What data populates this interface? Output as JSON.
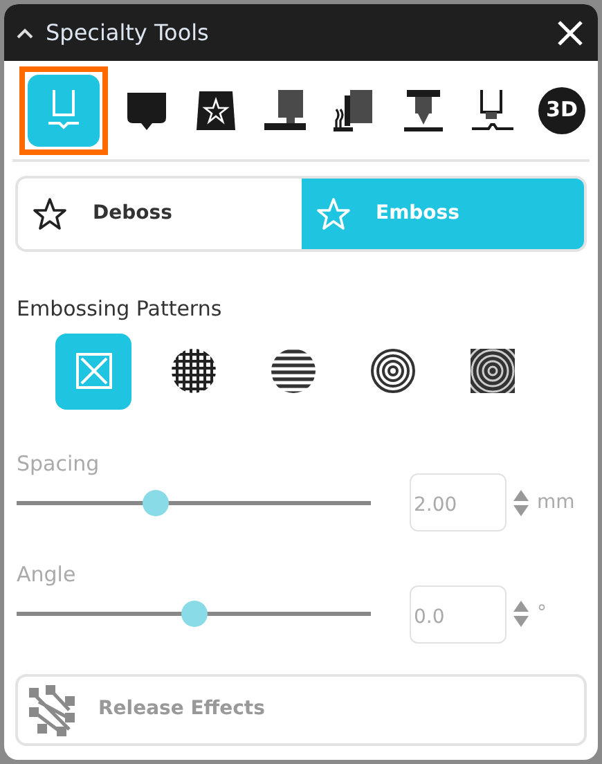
{
  "window": {
    "title": "Specialty Tools"
  },
  "tools": [
    {
      "kind": "cup",
      "selected": true
    },
    {
      "kind": "stamp",
      "selected": false
    },
    {
      "kind": "star",
      "selected": false
    },
    {
      "kind": "press",
      "selected": false
    },
    {
      "kind": "heat",
      "selected": false
    },
    {
      "kind": "drill",
      "selected": false
    },
    {
      "kind": "nozzle",
      "selected": false
    },
    {
      "kind": "badge",
      "selected": false,
      "label": "3D"
    }
  ],
  "modes": [
    {
      "label": "Deboss",
      "selected": false
    },
    {
      "label": "Emboss",
      "selected": true
    }
  ],
  "patterns_title": "Embossing Patterns",
  "patterns": [
    {
      "kind": "cross",
      "selected": true
    },
    {
      "kind": "grid",
      "selected": false
    },
    {
      "kind": "stripes",
      "selected": false
    },
    {
      "kind": "rings",
      "selected": false
    },
    {
      "kind": "square-rings",
      "selected": false
    }
  ],
  "sliders": [
    {
      "label": "Spacing",
      "level": 0.39,
      "value": "2.00",
      "unit": "mm",
      "disabled": true
    },
    {
      "label": "Angle",
      "level": 0.5,
      "value": "0.0",
      "unit": "°",
      "disabled": true
    }
  ],
  "release_button": {
    "label": "Release Effects",
    "disabled": true
  }
}
